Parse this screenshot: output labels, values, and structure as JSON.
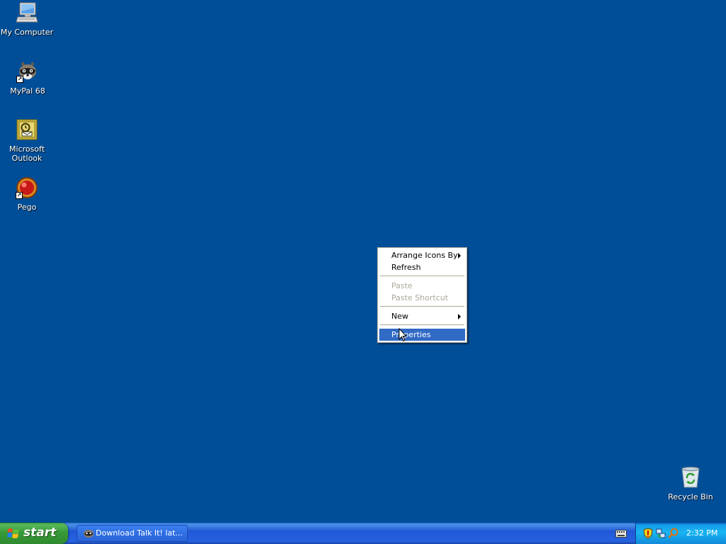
{
  "desktop": {
    "background_color": "#004e98",
    "icons": [
      {
        "label": "My Computer",
        "icon": "my-computer-icon"
      },
      {
        "label": "MyPal 68",
        "icon": "mypal-raccoon-icon"
      },
      {
        "label": "Microsoft Outlook",
        "icon": "outlook-icon"
      },
      {
        "label": "Pego",
        "icon": "pego-icon"
      },
      {
        "label": "Recycle Bin",
        "icon": "recycle-bin-icon"
      }
    ]
  },
  "context_menu": {
    "items": [
      {
        "label": "Arrange Icons By",
        "submenu": true,
        "enabled": true
      },
      {
        "label": "Refresh",
        "submenu": false,
        "enabled": true
      },
      {
        "label": "Paste",
        "submenu": false,
        "enabled": false
      },
      {
        "label": "Paste Shortcut",
        "submenu": false,
        "enabled": false
      },
      {
        "label": "New",
        "submenu": true,
        "enabled": true
      },
      {
        "label": "Properties",
        "submenu": false,
        "enabled": true,
        "highlighted": true
      }
    ],
    "highlight_color": "#316ac5"
  },
  "taskbar": {
    "start_label": "start",
    "tasks": [
      {
        "label": "Download Talk It! lat...",
        "icon": "raccoon-icon"
      }
    ],
    "tray": {
      "icons": [
        "security-shield-icon",
        "network-icon",
        "search-icon"
      ],
      "clock": "2:32 PM"
    }
  }
}
